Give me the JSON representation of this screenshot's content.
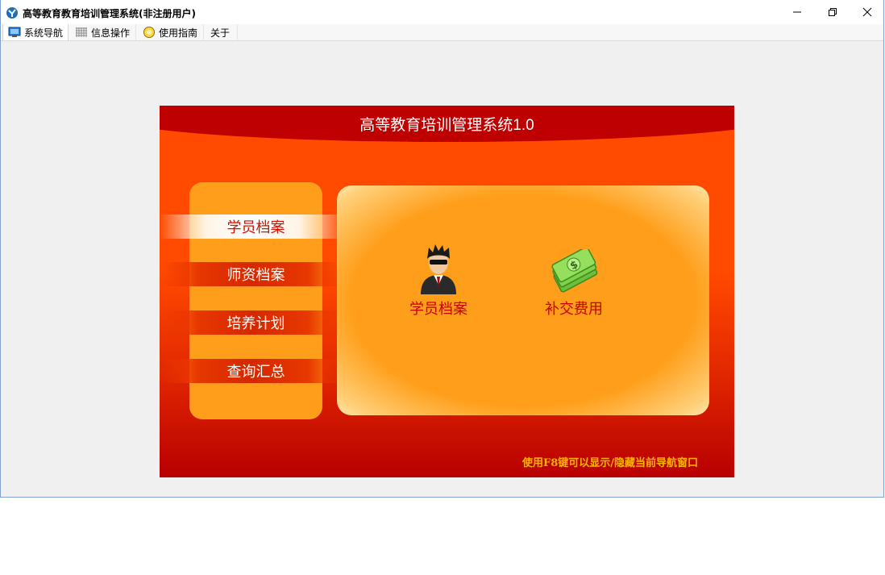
{
  "window": {
    "title": "高等教育教育培训管理系统(非注册用户)",
    "app_icon": "app-logo-icon",
    "controls": [
      "minimize-icon",
      "restore-icon",
      "close-icon"
    ]
  },
  "menu": {
    "items": [
      {
        "label": "系统导航",
        "icon": "monitor-icon"
      },
      {
        "label": "信息操作",
        "icon": "grid-icon"
      },
      {
        "label": "使用指南",
        "icon": "help-icon"
      },
      {
        "label": "关于",
        "icon": ""
      }
    ]
  },
  "panel": {
    "title": "高等教育培训管理系统1.0",
    "nav": [
      {
        "label": "学员档案",
        "active": true
      },
      {
        "label": "师资档案",
        "active": false
      },
      {
        "label": "培养计划",
        "active": false
      },
      {
        "label": "查询汇总",
        "active": false
      }
    ],
    "shortcuts": [
      {
        "label": "学员档案",
        "icon": "student-avatar-icon"
      },
      {
        "label": "补交费用",
        "icon": "money-icon"
      }
    ],
    "hint": "使用F8键可以显示/隐藏当前导航窗口"
  },
  "colors": {
    "panel_orange": "#ff4a00",
    "header_red": "#be0000",
    "nav_gold": "#ff9e1a",
    "label_red": "#c80000",
    "hint_yellow": "#ffb400"
  }
}
